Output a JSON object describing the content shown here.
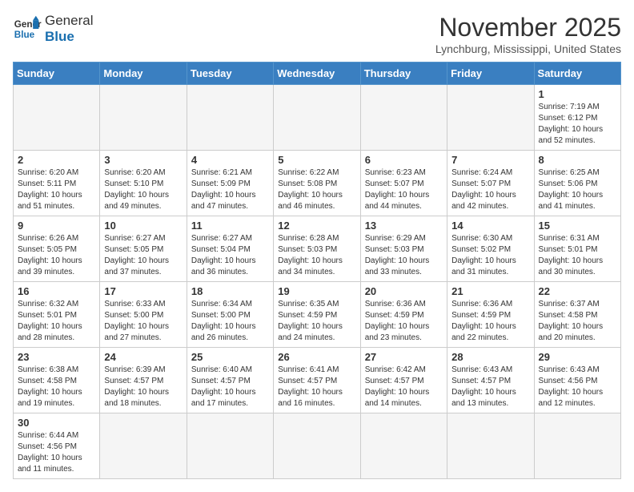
{
  "header": {
    "logo_general": "General",
    "logo_blue": "Blue",
    "month_title": "November 2025",
    "location": "Lynchburg, Mississippi, United States"
  },
  "weekdays": [
    "Sunday",
    "Monday",
    "Tuesday",
    "Wednesday",
    "Thursday",
    "Friday",
    "Saturday"
  ],
  "weeks": [
    [
      {
        "day": "",
        "info": ""
      },
      {
        "day": "",
        "info": ""
      },
      {
        "day": "",
        "info": ""
      },
      {
        "day": "",
        "info": ""
      },
      {
        "day": "",
        "info": ""
      },
      {
        "day": "",
        "info": ""
      },
      {
        "day": "1",
        "info": "Sunrise: 7:19 AM\nSunset: 6:12 PM\nDaylight: 10 hours and 52 minutes."
      }
    ],
    [
      {
        "day": "2",
        "info": "Sunrise: 6:20 AM\nSunset: 5:11 PM\nDaylight: 10 hours and 51 minutes."
      },
      {
        "day": "3",
        "info": "Sunrise: 6:20 AM\nSunset: 5:10 PM\nDaylight: 10 hours and 49 minutes."
      },
      {
        "day": "4",
        "info": "Sunrise: 6:21 AM\nSunset: 5:09 PM\nDaylight: 10 hours and 47 minutes."
      },
      {
        "day": "5",
        "info": "Sunrise: 6:22 AM\nSunset: 5:08 PM\nDaylight: 10 hours and 46 minutes."
      },
      {
        "day": "6",
        "info": "Sunrise: 6:23 AM\nSunset: 5:07 PM\nDaylight: 10 hours and 44 minutes."
      },
      {
        "day": "7",
        "info": "Sunrise: 6:24 AM\nSunset: 5:07 PM\nDaylight: 10 hours and 42 minutes."
      },
      {
        "day": "8",
        "info": "Sunrise: 6:25 AM\nSunset: 5:06 PM\nDaylight: 10 hours and 41 minutes."
      }
    ],
    [
      {
        "day": "9",
        "info": "Sunrise: 6:26 AM\nSunset: 5:05 PM\nDaylight: 10 hours and 39 minutes."
      },
      {
        "day": "10",
        "info": "Sunrise: 6:27 AM\nSunset: 5:05 PM\nDaylight: 10 hours and 37 minutes."
      },
      {
        "day": "11",
        "info": "Sunrise: 6:27 AM\nSunset: 5:04 PM\nDaylight: 10 hours and 36 minutes."
      },
      {
        "day": "12",
        "info": "Sunrise: 6:28 AM\nSunset: 5:03 PM\nDaylight: 10 hours and 34 minutes."
      },
      {
        "day": "13",
        "info": "Sunrise: 6:29 AM\nSunset: 5:03 PM\nDaylight: 10 hours and 33 minutes."
      },
      {
        "day": "14",
        "info": "Sunrise: 6:30 AM\nSunset: 5:02 PM\nDaylight: 10 hours and 31 minutes."
      },
      {
        "day": "15",
        "info": "Sunrise: 6:31 AM\nSunset: 5:01 PM\nDaylight: 10 hours and 30 minutes."
      }
    ],
    [
      {
        "day": "16",
        "info": "Sunrise: 6:32 AM\nSunset: 5:01 PM\nDaylight: 10 hours and 28 minutes."
      },
      {
        "day": "17",
        "info": "Sunrise: 6:33 AM\nSunset: 5:00 PM\nDaylight: 10 hours and 27 minutes."
      },
      {
        "day": "18",
        "info": "Sunrise: 6:34 AM\nSunset: 5:00 PM\nDaylight: 10 hours and 26 minutes."
      },
      {
        "day": "19",
        "info": "Sunrise: 6:35 AM\nSunset: 4:59 PM\nDaylight: 10 hours and 24 minutes."
      },
      {
        "day": "20",
        "info": "Sunrise: 6:36 AM\nSunset: 4:59 PM\nDaylight: 10 hours and 23 minutes."
      },
      {
        "day": "21",
        "info": "Sunrise: 6:36 AM\nSunset: 4:59 PM\nDaylight: 10 hours and 22 minutes."
      },
      {
        "day": "22",
        "info": "Sunrise: 6:37 AM\nSunset: 4:58 PM\nDaylight: 10 hours and 20 minutes."
      }
    ],
    [
      {
        "day": "23",
        "info": "Sunrise: 6:38 AM\nSunset: 4:58 PM\nDaylight: 10 hours and 19 minutes."
      },
      {
        "day": "24",
        "info": "Sunrise: 6:39 AM\nSunset: 4:57 PM\nDaylight: 10 hours and 18 minutes."
      },
      {
        "day": "25",
        "info": "Sunrise: 6:40 AM\nSunset: 4:57 PM\nDaylight: 10 hours and 17 minutes."
      },
      {
        "day": "26",
        "info": "Sunrise: 6:41 AM\nSunset: 4:57 PM\nDaylight: 10 hours and 16 minutes."
      },
      {
        "day": "27",
        "info": "Sunrise: 6:42 AM\nSunset: 4:57 PM\nDaylight: 10 hours and 14 minutes."
      },
      {
        "day": "28",
        "info": "Sunrise: 6:43 AM\nSunset: 4:57 PM\nDaylight: 10 hours and 13 minutes."
      },
      {
        "day": "29",
        "info": "Sunrise: 6:43 AM\nSunset: 4:56 PM\nDaylight: 10 hours and 12 minutes."
      }
    ],
    [
      {
        "day": "30",
        "info": "Sunrise: 6:44 AM\nSunset: 4:56 PM\nDaylight: 10 hours and 11 minutes."
      },
      {
        "day": "",
        "info": ""
      },
      {
        "day": "",
        "info": ""
      },
      {
        "day": "",
        "info": ""
      },
      {
        "day": "",
        "info": ""
      },
      {
        "day": "",
        "info": ""
      },
      {
        "day": "",
        "info": ""
      }
    ]
  ]
}
